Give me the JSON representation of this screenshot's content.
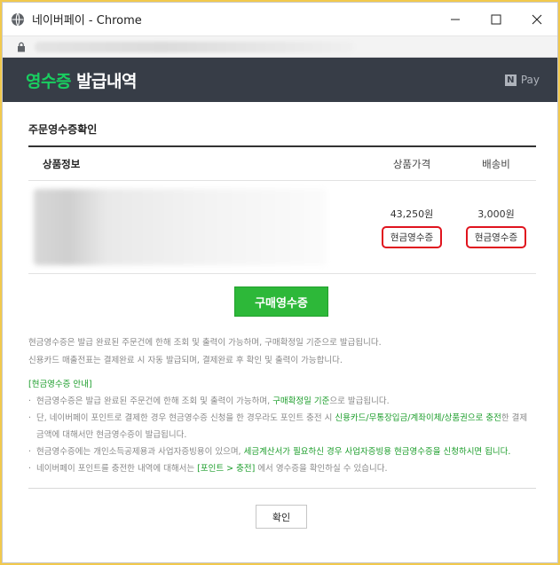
{
  "window": {
    "title": "네이버페이 - Chrome"
  },
  "header": {
    "title_accent": "영수증",
    "title_rest": " 발급내역",
    "brand_badge": "N",
    "brand_text": "Pay"
  },
  "section": {
    "title": "주문영수증확인"
  },
  "table": {
    "headers": {
      "product": "상품정보",
      "price": "상품가격",
      "shipping": "배송비"
    },
    "row": {
      "price_amount": "43,250원",
      "price_receipt_label": "현금영수증",
      "shipping_amount": "3,000원",
      "shipping_receipt_label": "현금영수증"
    }
  },
  "purchase_receipt_button": "구매영수증",
  "notes": {
    "line1": "현금영수증은 발급 완료된 주문건에 한해 조회 및 출력이 가능하며, 구매확정일 기준으로 발급됩니다.",
    "line2": "신용카드 매출전표는 결제완료 시 자동 발급되며, 결제완료 후 확인 및 출력이 가능합니다."
  },
  "guide": {
    "title": "[현금영수증 안내]",
    "item1_a": "현금영수증은 발급 완료된 주문건에 한해 조회 및 출력이 가능하며, ",
    "item1_b": "구매확정일 기준",
    "item1_c": "으로 발급됩니다.",
    "item2_a": "단, 네이버페이 포인트로 결제한 경우 현금영수증 신청을 한 경우라도 포인트 충전 시 ",
    "item2_b": "신용카드/무통장입금/계좌이체/상품권으로 충전",
    "item2_c": "한 결제 금액에 대해서만 현금영수증이 발급됩니다.",
    "item3_a": "현금영수증에는 개인소득공제용과 사업자증빙용이 있으며, ",
    "item3_b": "세금계산서가 필요하신 경우 사업자증빙용 현금영수증을 신청하시면 됩니다.",
    "item4_a": "네이버페이 포인트를 충전한 내역에 대해서는 ",
    "item4_b": "[포인트 > 충전]",
    "item4_c": " 에서 영수증을 확인하실 수 있습니다."
  },
  "confirm_button": "확인",
  "colors": {
    "header_bg": "#373d47",
    "accent_green": "#19ce60",
    "button_green": "#2db839",
    "highlight_red": "#e0141e",
    "frame_yellow": "#f2c94c"
  }
}
